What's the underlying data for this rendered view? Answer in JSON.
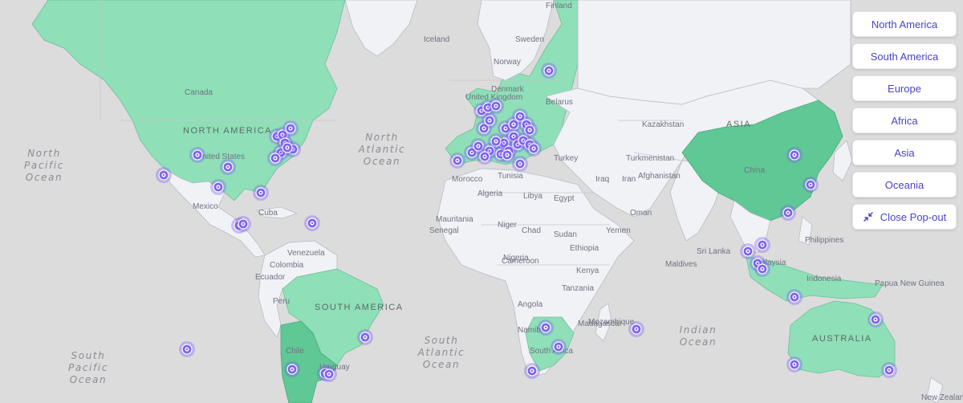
{
  "map": {
    "continent_labels": [
      "NORTH AMERICA",
      "SOUTH AMERICA",
      "ASIA",
      "AUSTRALIA"
    ],
    "ocean_labels": [
      {
        "lines": [
          "North",
          "Pacific",
          "Ocean"
        ]
      },
      {
        "lines": [
          "North",
          "Atlantic",
          "Ocean"
        ]
      },
      {
        "lines": [
          "South",
          "Atlantic",
          "Ocean"
        ]
      },
      {
        "lines": [
          "South",
          "Pacific",
          "Ocean"
        ]
      },
      {
        "lines": [
          "Indian",
          "Ocean"
        ]
      }
    ],
    "country_labels": [
      "Canada",
      "United States",
      "Mexico",
      "Cuba",
      "Venezuela",
      "Colombia",
      "Ecuador",
      "Peru",
      "Chile",
      "Uruguay",
      "Iceland",
      "Sweden",
      "Finland",
      "Norway",
      "Denmark",
      "United Kingdom",
      "Belarus",
      "Kazakhstan",
      "Turkmenistan",
      "Afghanistan",
      "Turkey",
      "Iraq",
      "Iran",
      "Oman",
      "Yemen",
      "Algeria",
      "Libya",
      "Egypt",
      "Mauritania",
      "Niger",
      "Chad",
      "Sudan",
      "Senegal",
      "Nigeria",
      "Ethiopia",
      "Cameroon",
      "Tanzania",
      "Kenya",
      "Angola",
      "Namibia",
      "Mozambique",
      "Madagascar",
      "South Africa",
      "Maldives",
      "Sri Lanka",
      "Philippines",
      "Malaysia",
      "Indonesia",
      "Papua New Guinea",
      "China",
      "New Zealand",
      "Morocco",
      "Tunisia"
    ]
  },
  "regions": {
    "buttons": [
      {
        "label": "North America"
      },
      {
        "label": "South America"
      },
      {
        "label": "Europe"
      },
      {
        "label": "Africa"
      },
      {
        "label": "Asia"
      },
      {
        "label": "Oceania"
      }
    ],
    "close_label": "Close Pop-out",
    "close_icon": "collapse-arrows-icon"
  },
  "colors": {
    "highlight": "#8fdfb8",
    "highlight_dark": "#5fc894",
    "marker": "#7e63f2",
    "button_text": "#4a43c8"
  }
}
